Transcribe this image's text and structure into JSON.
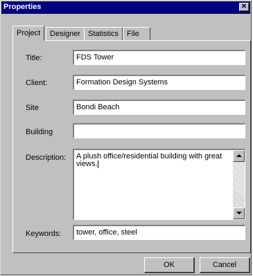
{
  "window": {
    "title": "Properties",
    "close_glyph": "✕"
  },
  "tabs": [
    {
      "label": "Project"
    },
    {
      "label": "Designer"
    },
    {
      "label": "Statistics"
    },
    {
      "label": "File"
    }
  ],
  "fields": {
    "title": {
      "label": "Title:",
      "value": "FDS Tower"
    },
    "client": {
      "label": "Client:",
      "value": "Formation Design Systems"
    },
    "site": {
      "label": "Site",
      "value": "Bondi Beach"
    },
    "building": {
      "label": "Building",
      "value": ""
    },
    "description": {
      "label": "Description:",
      "value": "A plush office/residential building with great views."
    },
    "keywords": {
      "label": "Keywords:",
      "value": "tower, office, steel"
    }
  },
  "buttons": {
    "ok": "OK",
    "cancel": "Cancel"
  },
  "icons": {
    "close": "close-icon",
    "scroll_up": "chevron-up-icon",
    "scroll_down": "chevron-down-icon"
  }
}
